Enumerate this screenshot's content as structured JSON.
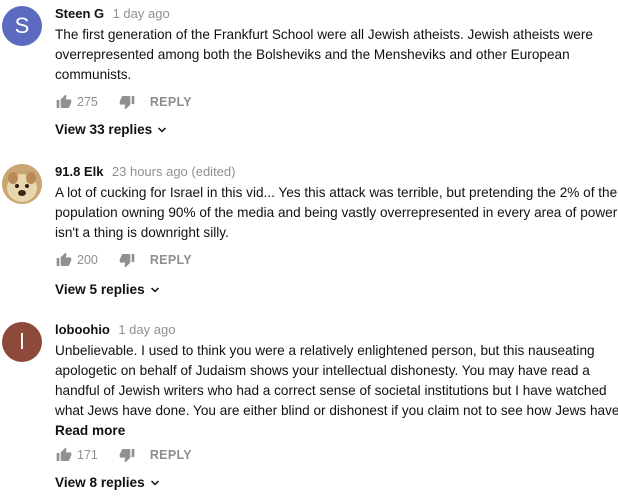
{
  "comments": [
    {
      "author": "Steen G",
      "time": "1 day ago",
      "avatar_letter": "S",
      "lines": [
        "The first generation of the Frankfurt School were all Jewish atheists.  Jewish atheists were",
        "overrepresented among both the Bolsheviks and the Mensheviks and other European",
        "communists."
      ],
      "likes": "275",
      "reply_label": "REPLY",
      "view_replies": "View 33 replies"
    },
    {
      "author": "91.8 Elk",
      "time": "23 hours ago (edited)",
      "lines": [
        "A lot of cucking for Israel in this vid... Yes this attack was terrible, but pretending the 2% of the",
        "population owning 90% of the media and being vastly overrepresented in every area of power",
        "isn't a thing is downright silly."
      ],
      "likes": "200",
      "reply_label": "REPLY",
      "view_replies": "View 5 replies"
    },
    {
      "author": "loboohio",
      "time": "1 day ago",
      "avatar_letter": "l",
      "lines": [
        "Unbelievable.  I used to think you were a relatively enlightened person, but this nauseating",
        "apologetic on behalf of Judaism shows your intellectual dishonesty.  You may have read a",
        "handful of Jewish writers who had a correct sense of societal institutions but I have watched",
        "what Jews have done. You are either blind or dishonest if you claim not to see how Jews have"
      ],
      "read_more": "Read more",
      "likes": "171",
      "reply_label": "REPLY",
      "view_replies": "View 8 replies"
    }
  ],
  "icons": {
    "like": "thumb-up-icon",
    "dislike": "thumb-down-icon",
    "expand": "chevron-down-icon"
  },
  "colors": {
    "avatar_s": "#5c6bc0",
    "avatar_l": "#8d4a3a",
    "meta_gray": "#909090"
  }
}
